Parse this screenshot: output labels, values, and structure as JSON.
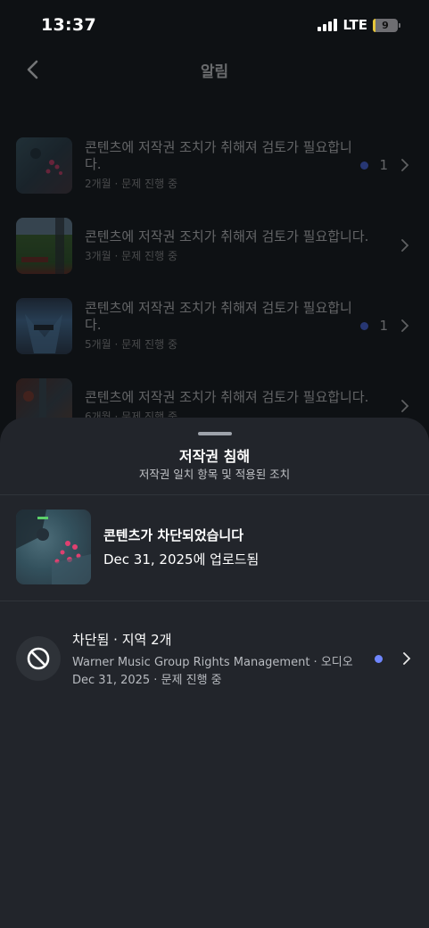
{
  "status_bar": {
    "time": "13:37",
    "network": "LTE",
    "battery": "9",
    "battery_level": 0.09
  },
  "header": {
    "title": "알림",
    "back_icon": "chevron-left-icon"
  },
  "notifications": [
    {
      "title": "콘텐츠에 저작권 조치가 취해져 검토가 필요합니다.",
      "meta": "2개월 · 문제 진행 중",
      "count": "1"
    },
    {
      "title": "콘텐츠에 저작권 조치가 취해져 검토가 필요합니다.",
      "meta": "3개월 · 문제 진행 중",
      "count": ""
    },
    {
      "title": "콘텐츠에 저작권 조치가 취해져 검토가 필요합니다.",
      "meta": "5개월 · 문제 진행 중",
      "count": "1"
    },
    {
      "title": "콘텐츠에 저작권 조치가 취해져 검토가 필요합니다.",
      "meta": "6개월 · 문제 진행 중",
      "count": ""
    }
  ],
  "sheet": {
    "title": "저작권 침해",
    "subtitle": "저작권 일치 항목 및 적용된 조치",
    "video": {
      "title": "콘텐츠가 차단되었습니다",
      "uploaded": "Dec 31, 2025에 업로드됨"
    },
    "claim": {
      "icon": "block-icon",
      "title": "차단됨 · 지역 2개",
      "owner": "Warner Music Group Rights Management · 오디오",
      "status": "Dec 31, 2025 · 문제 진행 중"
    }
  },
  "colors": {
    "background": "#0e1114",
    "sheet": "#22252b",
    "accent_dot": "#6f86ff",
    "list_dot": "#4a6cf7"
  }
}
